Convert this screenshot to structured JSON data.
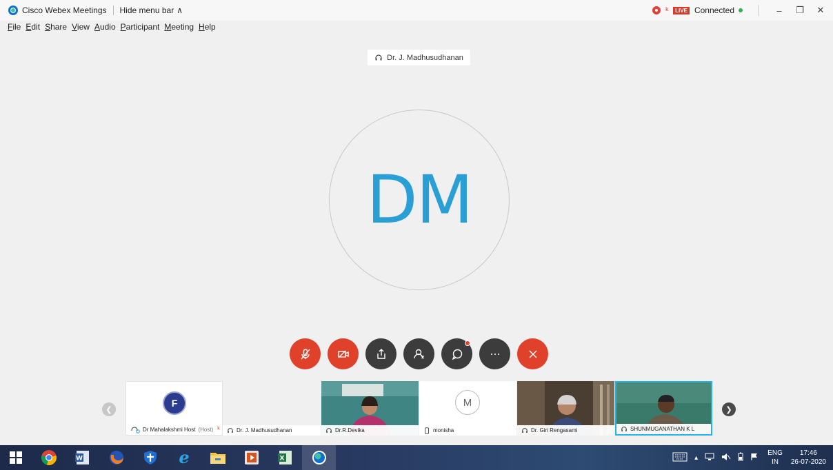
{
  "titlebar": {
    "app_title": "Cisco Webex Meetings",
    "hide_menu_label": "Hide menu bar",
    "live_label": "LIVE",
    "status": "Connected"
  },
  "menu": [
    {
      "label": "File"
    },
    {
      "label": "Edit"
    },
    {
      "label": "Share"
    },
    {
      "label": "View"
    },
    {
      "label": "Audio"
    },
    {
      "label": "Participant"
    },
    {
      "label": "Meeting"
    },
    {
      "label": "Help"
    }
  ],
  "stage": {
    "active_speaker": "Dr. J. Madhusudhanan",
    "avatar_initials": "DM"
  },
  "controls": {
    "mute_state": "muted",
    "video_state": "off",
    "chat_has_unread": true,
    "colors": {
      "red": "#e0412b",
      "dark": "#3c3c3c"
    }
  },
  "thumbnails": [
    {
      "name": "Dr Mahalakshmi Host",
      "tag": "(Host)",
      "muted": true
    },
    {
      "name": "Dr. J. Madhusudhanan"
    },
    {
      "name": "Dr.R.Devika"
    },
    {
      "name": "monisha",
      "avatar_initial": "M"
    },
    {
      "name": "Dr. Giri Rengasami"
    },
    {
      "name": "SHUNMUGANATHAN K L",
      "active": true
    }
  ],
  "taskbar": {
    "language": "ENG",
    "region": "IN",
    "time": "17:46",
    "date": "26-07-2020"
  },
  "accent": "#2a9fd6"
}
